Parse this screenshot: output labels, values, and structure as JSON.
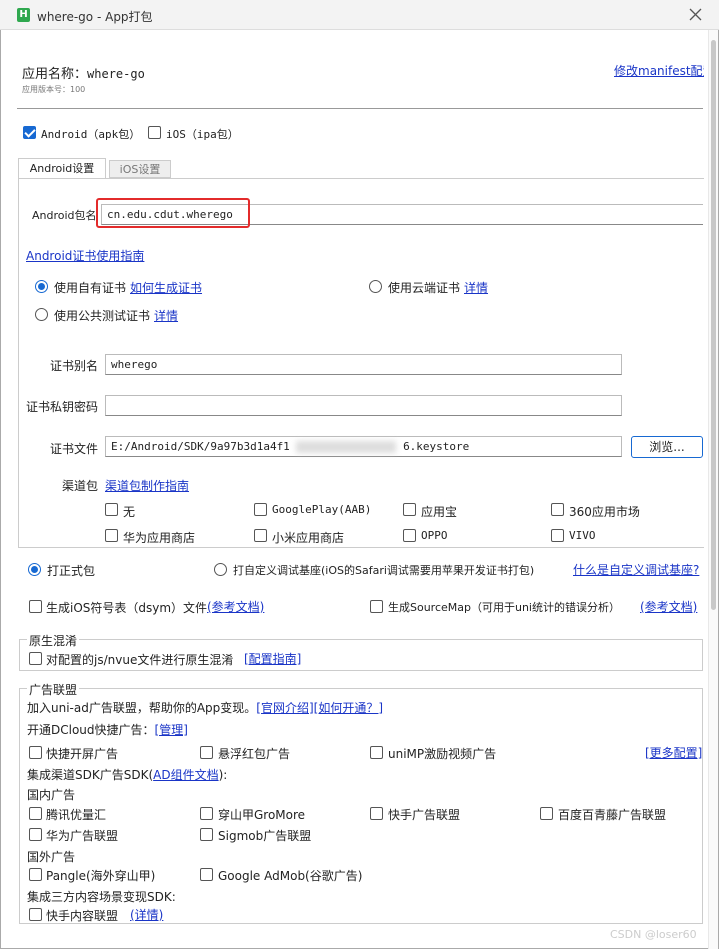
{
  "window": {
    "title": "where-go - App打包",
    "close_icon": "close-icon"
  },
  "header": {
    "app_name_label": "应用名称：",
    "app_name": "where-go",
    "version_label": "应用版本号：",
    "version": "100",
    "manifest_link": "修改manifest配置"
  },
  "platforms": {
    "android": "Android（apk包）",
    "ios": "iOS（ipa包）"
  },
  "tabs": {
    "android": "Android设置",
    "ios": "iOS设置"
  },
  "android": {
    "package_label": "Android包名",
    "package_value": "cn.edu.cdut.wherego",
    "cert_guide": "Android证书使用指南",
    "cert_own": "使用自有证书",
    "cert_own_link": "如何生成证书",
    "cert_cloud": "使用云端证书",
    "cert_cloud_link": "详情",
    "cert_public": "使用公共测试证书",
    "cert_public_link": "详情",
    "alias_label": "证书别名",
    "alias_value": "wherego",
    "password_label": "证书私钥密码",
    "password_value": "",
    "file_label": "证书文件",
    "file_value_start": "E:/Android/SDK/9a97b3d1a4f1",
    "file_value_end": "6.keystore",
    "browse_btn": "浏览...",
    "channel_label": "渠道包",
    "channel_link": "渠道包制作指南",
    "channels": [
      "无",
      "GooglePlay(AAB)",
      "应用宝",
      "360应用市场",
      "华为应用商店",
      "小米应用商店",
      "OPPO",
      "VIVO"
    ]
  },
  "build": {
    "formal": "打正式包",
    "custom": "打自定义调试基座(iOS的Safari调试需要用苹果开发证书打包)",
    "custom_link": "什么是自定义调试基座?",
    "dsym": "生成iOS符号表（dsym）文件",
    "dsym_link": "(参考文档)",
    "sourcemap": "生成SourceMap（可用于uni统计的错误分析）",
    "sourcemap_link": "(参考文档)"
  },
  "native_obfuscation": {
    "legend": "原生混淆",
    "option": "对配置的js/nvue文件进行原生混淆",
    "link": "[配置指南]"
  },
  "ads": {
    "legend": "广告联盟",
    "intro": "加入uni-ad广告联盟，帮助你的App变现。",
    "intro_link1": "[官网介绍]",
    "intro_link2": "[如何开通？]",
    "dcloud_label": "开通DCloud快捷广告：",
    "dcloud_link": "[管理]",
    "quick_ads": [
      "快捷开屏广告",
      "悬浮红包广告",
      "uniMP激励视频广告"
    ],
    "more_link": "[更多配置]",
    "sdk_label": "集成渠道SDK广告SDK(",
    "sdk_link": "AD组件文档",
    "sdk_label_end": "):",
    "domestic_label": "国内广告",
    "domestic": [
      "腾讯优量汇",
      "穿山甲GroMore",
      "快手广告联盟",
      "百度百青藤广告联盟",
      "华为广告联盟",
      "Sigmob广告联盟"
    ],
    "overseas_label": "国外广告",
    "overseas": [
      "Pangle(海外穿山甲)",
      "Google AdMob(谷歌广告)"
    ],
    "thirdparty_label": "集成三方内容场景变现SDK:",
    "thirdparty": "快手内容联盟",
    "thirdparty_link": "(详情)"
  },
  "watermark": "CSDN @loser60"
}
